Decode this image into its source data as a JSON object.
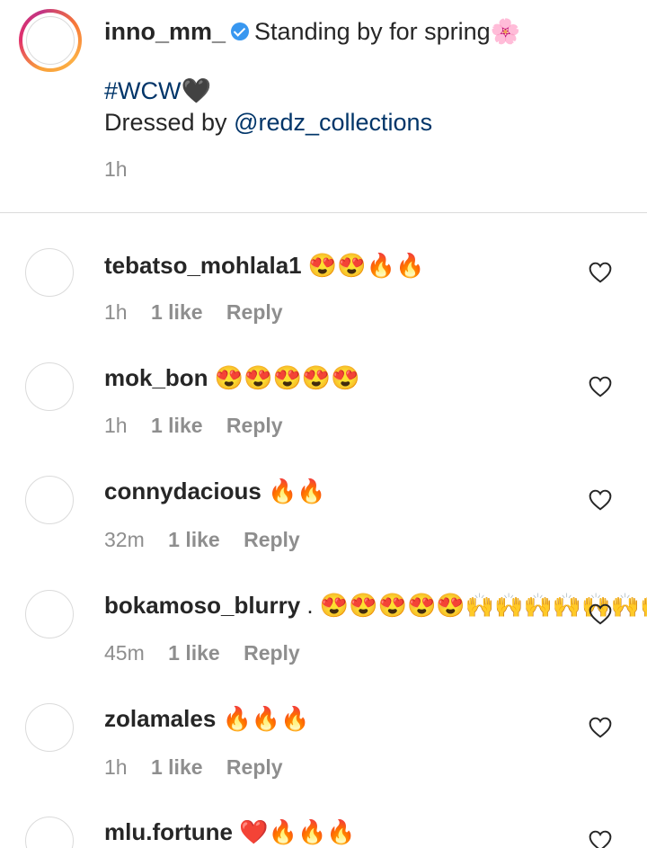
{
  "caption": {
    "username": "inno_mm_",
    "text": "Standing by for spring🌸",
    "hashtag": "#WCW🖤",
    "dressed_by_prefix": "Dressed by ",
    "mention": "@redz_collections",
    "time": "1h"
  },
  "comments": [
    {
      "username": "tebatso_mohlala1",
      "text": "😍😍🔥🔥",
      "time": "1h",
      "likes": "1 like",
      "reply": "Reply"
    },
    {
      "username": "mok_bon",
      "text": "😍😍😍😍😍",
      "time": "1h",
      "likes": "1 like",
      "reply": "Reply"
    },
    {
      "username": "connydacious",
      "text": "🔥🔥",
      "time": "32m",
      "likes": "1 like",
      "reply": "Reply"
    },
    {
      "username": "bokamoso_blurry",
      "text": ". 😍😍😍😍😍🙌🙌🙌🙌🙌🙌🙌",
      "time": "45m",
      "likes": "1 like",
      "reply": "Reply"
    },
    {
      "username": "zolamales",
      "text": "🔥🔥🔥",
      "time": "1h",
      "likes": "1 like",
      "reply": "Reply"
    },
    {
      "username": "mlu.fortune",
      "text": "❤️🔥🔥🔥",
      "time": "",
      "likes": "",
      "reply": ""
    }
  ]
}
